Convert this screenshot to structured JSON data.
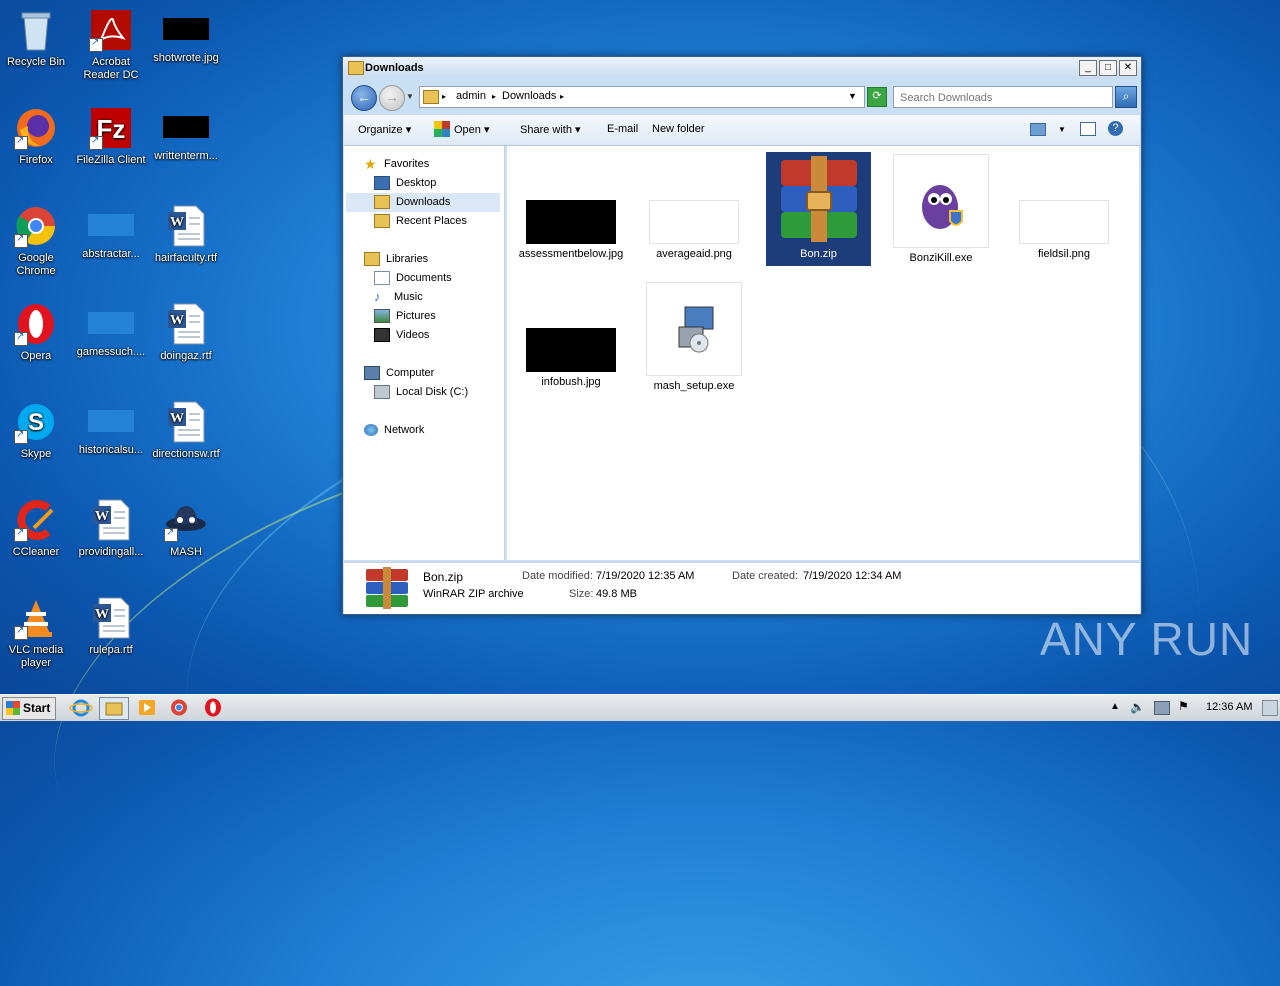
{
  "desktop": {
    "icons": [
      {
        "label": "Recycle Bin"
      },
      {
        "label": "Acrobat Reader DC"
      },
      {
        "label": "shotwrote.jpg"
      },
      {
        "label": "Firefox"
      },
      {
        "label": "FileZilla Client"
      },
      {
        "label": "writtenterm..."
      },
      {
        "label": "Google Chrome"
      },
      {
        "label": "abstractar..."
      },
      {
        "label": "hairfaculty.rtf"
      },
      {
        "label": "Opera"
      },
      {
        "label": "gamessuch...."
      },
      {
        "label": "doingaz.rtf"
      },
      {
        "label": "Skype"
      },
      {
        "label": "historicalsu..."
      },
      {
        "label": "directionsw.rtf"
      },
      {
        "label": "CCleaner"
      },
      {
        "label": "providingall..."
      },
      {
        "label": "MASH"
      },
      {
        "label": "VLC media player"
      },
      {
        "label": "rulepa.rtf"
      }
    ]
  },
  "window": {
    "title": "Downloads",
    "address": {
      "crumbs": [
        "admin",
        "Downloads"
      ]
    },
    "search_placeholder": "Search Downloads",
    "toolbar": {
      "organize": "Organize",
      "open": "Open",
      "share_with": "Share with",
      "email": "E-mail",
      "new_folder": "New folder"
    },
    "nav": {
      "favorites": "Favorites",
      "desktop": "Desktop",
      "downloads": "Downloads",
      "recent_places": "Recent Places",
      "libraries": "Libraries",
      "documents": "Documents",
      "music": "Music",
      "pictures": "Pictures",
      "videos": "Videos",
      "computer": "Computer",
      "local_disk": "Local Disk (C:)",
      "network": "Network"
    },
    "files": [
      {
        "name": "assessmentbelow.jpg"
      },
      {
        "name": "averageaid.png"
      },
      {
        "name": "Bon.zip"
      },
      {
        "name": "BonziKill.exe"
      },
      {
        "name": "fieldsil.png"
      },
      {
        "name": "infobush.jpg"
      },
      {
        "name": "mash_setup.exe"
      }
    ],
    "details": {
      "name": "Bon.zip",
      "type": "WinRAR ZIP archive",
      "modified_label": "Date modified:",
      "modified": "7/19/2020 12:35 AM",
      "created_label": "Date created:",
      "created": "7/19/2020 12:34 AM",
      "size_label": "Size:",
      "size": "49.8 MB"
    }
  },
  "watermark": "ANY RUN",
  "taskbar": {
    "start": "Start",
    "clock": "12:36 AM"
  },
  "colors": {
    "selection": "#1c3d7a",
    "nav_selected": "#d9e7f6"
  }
}
